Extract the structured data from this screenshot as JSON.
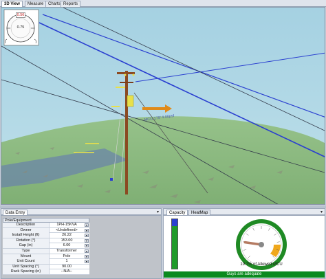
{
  "tabs": [
    "3D View",
    "Measure",
    "Charts",
    "Reports"
  ],
  "compass": {
    "top": "0.56",
    "center": "0.75"
  },
  "scene": {
    "colors": {
      "sky": "#aad4e4",
      "ground": "#8cba80",
      "pole": "#8b4a22",
      "span_blue": "#2a3fd0",
      "span_dark": "#333a4a"
    },
    "annotation": "MCU 179' 4.00psf"
  },
  "data_entry": {
    "tab": "Data Entry",
    "dropdown": "▾",
    "section": "Pole/Equipment",
    "rows": [
      {
        "label": "Description",
        "value": "1PH-15KVA",
        "button": "▾"
      },
      {
        "label": "Owner",
        "value": "<Undefined>",
        "button": "▾"
      },
      {
        "label": "Install Height (ft)",
        "value": "26.22",
        "button": "▾"
      },
      {
        "label": "Rotation (°)",
        "value": "153.00",
        "button": "▾"
      },
      {
        "label": "Gap (in)",
        "value": "6.00",
        "button": "▾"
      },
      {
        "label": "Type",
        "value": "Transformer",
        "button": "▾"
      },
      {
        "label": "Mount",
        "value": "Pole",
        "button": "▾"
      },
      {
        "label": "Unit Count",
        "value": "1",
        "button": "▾"
      },
      {
        "label": "Unit Spacing (°)",
        "value": "90.00",
        "button": ""
      },
      {
        "label": "Rack Spacing (in)",
        "value": "--N/A--",
        "button": ""
      }
    ]
  },
  "capacity": {
    "tabs": [
      "Capacity",
      "HeatMap"
    ],
    "dropdown": "▾",
    "gauge_fraction": 0.197,
    "gauge_text": "19.7% of Allowed MCU",
    "status": "Guys are adequate",
    "colors": {
      "bar_fill": "#1f9a2a",
      "bar_top": "#2a3fd0",
      "ring": "#1f8a24",
      "needle": "#b57b62",
      "warn": "#f0a81c"
    }
  }
}
